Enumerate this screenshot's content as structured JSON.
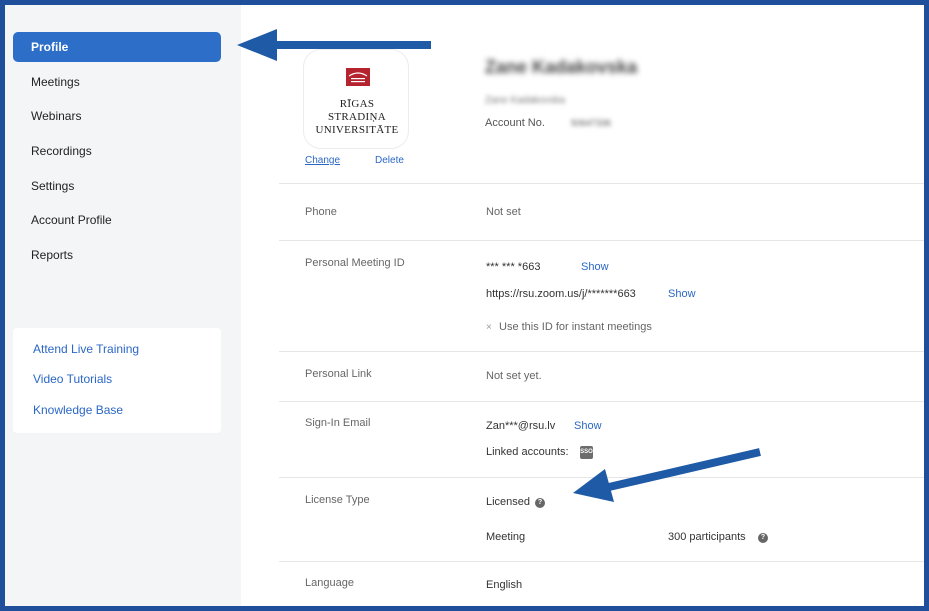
{
  "sidebar": {
    "items": [
      {
        "label": "Profile",
        "active": true
      },
      {
        "label": "Meetings"
      },
      {
        "label": "Webinars"
      },
      {
        "label": "Recordings"
      },
      {
        "label": "Settings"
      },
      {
        "label": "Account Profile"
      },
      {
        "label": "Reports"
      }
    ],
    "help_links": [
      "Attend Live Training",
      "Video Tutorials",
      "Knowledge Base"
    ]
  },
  "profile": {
    "logo_lines": [
      "RĪGAS",
      "STRADIŅA",
      "UNIVERSITĀTE"
    ],
    "change_label": "Change",
    "delete_label": "Delete",
    "name": "Zane Kadakovska",
    "name_sub": "Zane Kadakovska",
    "account_label": "Account No.",
    "account_value": "50647336"
  },
  "rows": {
    "phone": {
      "label": "Phone",
      "value": "Not set"
    },
    "pmi": {
      "label": "Personal Meeting ID",
      "id": "*** *** *663",
      "show_label": "Show",
      "url": "https://rsu.zoom.us/j/*******663",
      "url_show_label": "Show",
      "instant": "Use this ID for instant meetings",
      "instant_mark": "×"
    },
    "personal_link": {
      "label": "Personal Link",
      "value": "Not set yet."
    },
    "signin": {
      "label": "Sign-In Email",
      "email": "Zan***@rsu.lv",
      "show_label": "Show",
      "linked": "Linked accounts:",
      "sso_badge": "SSO"
    },
    "license": {
      "label": "License Type",
      "value": "Licensed",
      "meeting_label": "Meeting",
      "meeting_value": "300 participants"
    },
    "language": {
      "label": "Language",
      "value": "English"
    }
  },
  "colors": {
    "frame": "#1f4e9a",
    "accent": "#2d6ec9",
    "link": "#2b67c5",
    "arrow": "#1f5aa6"
  },
  "icons": {
    "help": "question-circle-icon",
    "sso": "sso-badge-icon",
    "logo": "university-logo-icon",
    "arrow": "annotation-arrow"
  }
}
